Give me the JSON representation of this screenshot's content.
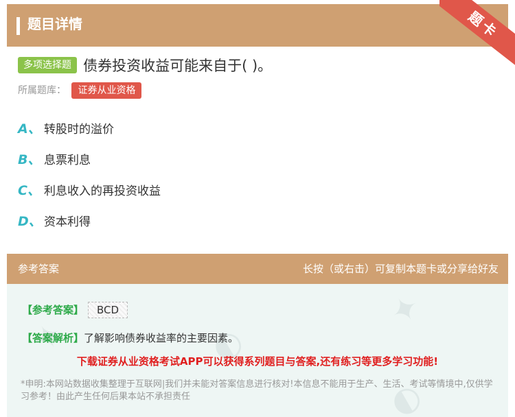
{
  "header": {
    "title": "题目详情",
    "ribbon": "题卡"
  },
  "question": {
    "type_badge": "多项选择题",
    "text": "债券投资收益可能来自于( )。",
    "bank_label": "所属题库：",
    "bank_name": "证券从业资格"
  },
  "options": [
    {
      "letter": "A、",
      "text": "转股时的溢价"
    },
    {
      "letter": "B、",
      "text": "息票利息"
    },
    {
      "letter": "C、",
      "text": "利息收入的再投资收益"
    },
    {
      "letter": "D、",
      "text": "资本利得"
    }
  ],
  "answer_section": {
    "title": "参考答案",
    "hint": "长按（或右击）可复制本题卡或分享给好友",
    "answer_label": "【参考答案】",
    "answer_value": "BCD",
    "analysis_label": "【答案解析】",
    "analysis_text": "了解影响债券收益率的主要因素。",
    "promo": "下载证券从业资格考试APP可以获得系列题目与答案,还有练习等更多学习功能!",
    "disclaimer": "*申明:本网站数据收集整理于互联网|我们并未能对答案信息进行核对!本信息不能用于生产、生活、考试等情境中,仅供学习参考！由此产生任何后果本站不承担责任"
  }
}
